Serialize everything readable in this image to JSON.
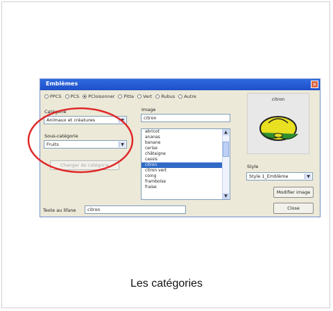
{
  "dialog": {
    "title": "Emblèmes",
    "close_glyph": "×",
    "radio_options": [
      "PPCS",
      "PCS",
      "PCloisonner",
      "Pitte",
      "Vert",
      "Rubus",
      "Autre"
    ],
    "category_label": "Catégorie",
    "category_value": "Animaux et créatures",
    "subcategory_label": "Sous-catégorie",
    "subcategory_value": "Fruits",
    "change_button": "Changer de catégorie",
    "image_label": "Image",
    "image_value": "citron",
    "list_items": [
      "abricot",
      "ananas",
      "banane",
      "cerise",
      "châtaigne",
      "cassis",
      "citron",
      "citron vert",
      "coing",
      "framboise",
      "fraise"
    ],
    "selected_index": 6,
    "preview_label": "citron",
    "style_label": "Style",
    "style_value": "Style 1_Emblème",
    "modify_button": "Modifier image",
    "close_button": "Close",
    "text_label": "Texte au lifane",
    "text_value": "citron"
  },
  "caption": "Les catégories",
  "colors": {
    "titlebar": "#2a5fd8",
    "selection": "#316ac5",
    "annotation": "#e0282a",
    "dialog_bg": "#ece9d8"
  },
  "icons": {
    "lemon": "lemon-icon",
    "close": "close-icon",
    "dropdown": "chevron-down-icon"
  }
}
